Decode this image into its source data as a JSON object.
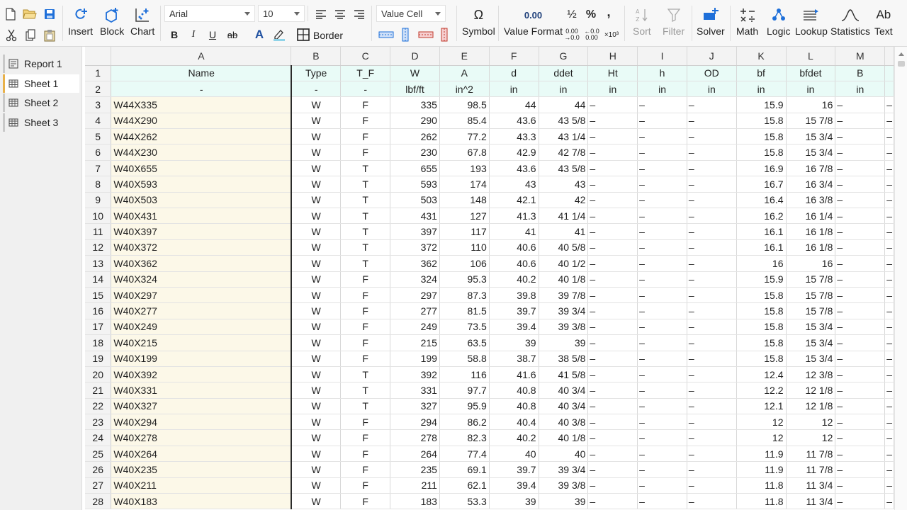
{
  "toolbar": {
    "font": "Arial",
    "size": "10",
    "cell_type": "Value Cell",
    "buttons": {
      "insert": "Insert",
      "block": "Block",
      "chart": "Chart",
      "border": "Border",
      "symbol": "Symbol",
      "value_format": "Value Format",
      "sort": "Sort",
      "filter": "Filter",
      "solver": "Solver",
      "math": "Math",
      "logic": "Logic",
      "lookup": "Lookup",
      "statistics": "Statistics",
      "text": "Text"
    },
    "glyphs": {
      "bold": "B",
      "italic": "I",
      "underline": "U",
      "strike": "ab",
      "symbol": "Ω",
      "half": "½",
      "percent": "%",
      "comma": ",",
      "text_icon": "Ab",
      "font_color": "A"
    }
  },
  "sidebar": {
    "items": [
      {
        "label": "Report 1",
        "icon": "report-icon"
      },
      {
        "label": "Sheet 1",
        "icon": "sheet-icon"
      },
      {
        "label": "Sheet 2",
        "icon": "sheet-icon"
      },
      {
        "label": "Sheet 3",
        "icon": "sheet-icon"
      }
    ],
    "active": "Sheet 1"
  },
  "grid": {
    "columns": [
      "A",
      "B",
      "C",
      "D",
      "E",
      "F",
      "G",
      "H",
      "I",
      "J",
      "K",
      "L",
      "M"
    ],
    "header_row_1": [
      "Name",
      "Type",
      "T_F",
      "W",
      "A",
      "d",
      "ddet",
      "Ht",
      "h",
      "OD",
      "bf",
      "bfdet",
      "B"
    ],
    "header_row_2": [
      "-",
      "-",
      "-",
      "lbf/ft",
      "in^2",
      "in",
      "in",
      "in",
      "in",
      "in",
      "in",
      "in",
      "in"
    ],
    "dash": "–",
    "rows": [
      [
        "3",
        "W44X335",
        "W",
        "F",
        "335",
        "98.5",
        "44",
        "44",
        "–",
        "–",
        "–",
        "15.9",
        "16",
        "–",
        "–"
      ],
      [
        "4",
        "W44X290",
        "W",
        "F",
        "290",
        "85.4",
        "43.6",
        "43 5/8",
        "–",
        "–",
        "–",
        "15.8",
        "15 7/8",
        "–",
        "–"
      ],
      [
        "5",
        "W44X262",
        "W",
        "F",
        "262",
        "77.2",
        "43.3",
        "43 1/4",
        "–",
        "–",
        "–",
        "15.8",
        "15 3/4",
        "–",
        "–"
      ],
      [
        "6",
        "W44X230",
        "W",
        "F",
        "230",
        "67.8",
        "42.9",
        "42 7/8",
        "–",
        "–",
        "–",
        "15.8",
        "15 3/4",
        "–",
        "–"
      ],
      [
        "7",
        "W40X655",
        "W",
        "T",
        "655",
        "193",
        "43.6",
        "43 5/8",
        "–",
        "–",
        "–",
        "16.9",
        "16 7/8",
        "–",
        "–"
      ],
      [
        "8",
        "W40X593",
        "W",
        "T",
        "593",
        "174",
        "43",
        "43",
        "–",
        "–",
        "–",
        "16.7",
        "16 3/4",
        "–",
        "–"
      ],
      [
        "9",
        "W40X503",
        "W",
        "T",
        "503",
        "148",
        "42.1",
        "42",
        "–",
        "–",
        "–",
        "16.4",
        "16 3/8",
        "–",
        "–"
      ],
      [
        "10",
        "W40X431",
        "W",
        "T",
        "431",
        "127",
        "41.3",
        "41 1/4",
        "–",
        "–",
        "–",
        "16.2",
        "16 1/4",
        "–",
        "–"
      ],
      [
        "11",
        "W40X397",
        "W",
        "T",
        "397",
        "117",
        "41",
        "41",
        "–",
        "–",
        "–",
        "16.1",
        "16 1/8",
        "–",
        "–"
      ],
      [
        "12",
        "W40X372",
        "W",
        "T",
        "372",
        "110",
        "40.6",
        "40 5/8",
        "–",
        "–",
        "–",
        "16.1",
        "16 1/8",
        "–",
        "–"
      ],
      [
        "13",
        "W40X362",
        "W",
        "T",
        "362",
        "106",
        "40.6",
        "40 1/2",
        "–",
        "–",
        "–",
        "16",
        "16",
        "–",
        "–"
      ],
      [
        "14",
        "W40X324",
        "W",
        "F",
        "324",
        "95.3",
        "40.2",
        "40 1/8",
        "–",
        "–",
        "–",
        "15.9",
        "15 7/8",
        "–",
        "–"
      ],
      [
        "15",
        "W40X297",
        "W",
        "F",
        "297",
        "87.3",
        "39.8",
        "39 7/8",
        "–",
        "–",
        "–",
        "15.8",
        "15 7/8",
        "–",
        "–"
      ],
      [
        "16",
        "W40X277",
        "W",
        "F",
        "277",
        "81.5",
        "39.7",
        "39 3/4",
        "–",
        "–",
        "–",
        "15.8",
        "15 7/8",
        "–",
        "–"
      ],
      [
        "17",
        "W40X249",
        "W",
        "F",
        "249",
        "73.5",
        "39.4",
        "39 3/8",
        "–",
        "–",
        "–",
        "15.8",
        "15 3/4",
        "–",
        "–"
      ],
      [
        "18",
        "W40X215",
        "W",
        "F",
        "215",
        "63.5",
        "39",
        "39",
        "–",
        "–",
        "–",
        "15.8",
        "15 3/4",
        "–",
        "–"
      ],
      [
        "19",
        "W40X199",
        "W",
        "F",
        "199",
        "58.8",
        "38.7",
        "38 5/8",
        "–",
        "–",
        "–",
        "15.8",
        "15 3/4",
        "–",
        "–"
      ],
      [
        "20",
        "W40X392",
        "W",
        "T",
        "392",
        "116",
        "41.6",
        "41 5/8",
        "–",
        "–",
        "–",
        "12.4",
        "12 3/8",
        "–",
        "–"
      ],
      [
        "21",
        "W40X331",
        "W",
        "T",
        "331",
        "97.7",
        "40.8",
        "40 3/4",
        "–",
        "–",
        "–",
        "12.2",
        "12 1/8",
        "–",
        "–"
      ],
      [
        "22",
        "W40X327",
        "W",
        "T",
        "327",
        "95.9",
        "40.8",
        "40 3/4",
        "–",
        "–",
        "–",
        "12.1",
        "12 1/8",
        "–",
        "–"
      ],
      [
        "23",
        "W40X294",
        "W",
        "F",
        "294",
        "86.2",
        "40.4",
        "40 3/8",
        "–",
        "–",
        "–",
        "12",
        "12",
        "–",
        "–"
      ],
      [
        "24",
        "W40X278",
        "W",
        "F",
        "278",
        "82.3",
        "40.2",
        "40 1/8",
        "–",
        "–",
        "–",
        "12",
        "12",
        "–",
        "–"
      ],
      [
        "25",
        "W40X264",
        "W",
        "F",
        "264",
        "77.4",
        "40",
        "40",
        "–",
        "–",
        "–",
        "11.9",
        "11 7/8",
        "–",
        "–"
      ],
      [
        "26",
        "W40X235",
        "W",
        "F",
        "235",
        "69.1",
        "39.7",
        "39 3/4",
        "–",
        "–",
        "–",
        "11.9",
        "11 7/8",
        "–",
        "–"
      ],
      [
        "27",
        "W40X211",
        "W",
        "F",
        "211",
        "62.1",
        "39.4",
        "39 3/8",
        "–",
        "–",
        "–",
        "11.8",
        "11 3/4",
        "–",
        "–"
      ],
      [
        "28",
        "W40X183",
        "W",
        "F",
        "183",
        "53.3",
        "39",
        "39",
        "–",
        "–",
        "–",
        "11.8",
        "11 3/4",
        "–",
        "–"
      ]
    ]
  },
  "colors": {
    "accent_blue": "#1e6fd9",
    "name_bg": "#fcf8e8",
    "header_bg": "#e9fbf7",
    "active_tab": "#e8b14a"
  }
}
